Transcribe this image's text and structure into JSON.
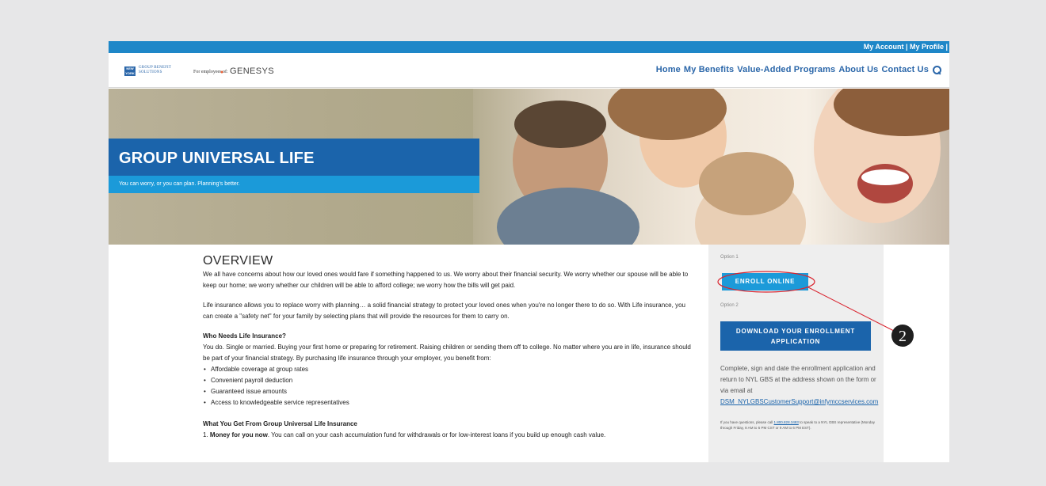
{
  "utility": {
    "text": "My Account | My Profile |"
  },
  "header": {
    "nyl_logo": "NEW YORK LIFE",
    "gbs_line1": "GROUP BENEFIT",
    "gbs_line2": "SOLUTIONS",
    "for_employees": "For employees of:",
    "client": "GENESYS"
  },
  "nav": {
    "items": [
      "Home",
      "My Benefits",
      "Value-Added Programs",
      "About Us",
      "Contact Us"
    ],
    "search_icon": "search-icon"
  },
  "hero": {
    "title": "GROUP UNIVERSAL LIFE",
    "subtitle": "You can worry, or you can plan. Planning's better."
  },
  "overview": {
    "title": "OVERVIEW",
    "p1": "We all have concerns about how our loved ones would fare if something happened to us. We worry about their financial security. We worry whether our spouse will be able to keep our home; we worry whether our children will be able to afford college; we worry how the bills will get paid.",
    "p2": "Life insurance allows you to replace worry with planning… a solid financial strategy to protect your loved ones when you're no longer there to do so. With Life insurance, you can create a \"safety net\" for your family by selecting plans that will provide the resources for them to carry on.",
    "who_heading": "Who Needs Life Insurance?",
    "who_text": "You do. Single or married. Buying your first home or preparing for retirement. Raising children or sending them off to college. No matter where you are in life, insurance should be part of your financial strategy. By purchasing life insurance through your employer, you benefit from:",
    "benefits": [
      "Affordable coverage at group rates",
      "Convenient payroll deduction",
      "Guaranteed issue amounts",
      "Access to knowledgeable service representatives"
    ],
    "what_heading": "What You Get From Group Universal Life Insurance",
    "money_prefix": "1. ",
    "money_bold": "Money for you now",
    "money_text": ". You can call on your cash accumulation fund for withdrawals or for low-interest loans if you build up enough cash value."
  },
  "sidebar": {
    "option1": "Option 1",
    "enroll": "ENROLL ONLINE",
    "option2": "Option 2",
    "download_line1": "DOWNLOAD YOUR ENROLLMENT",
    "download_line2": "APPLICATION",
    "instructions": "Complete, sign and date the enrollment application and return to NYL GBS at the address shown on the form or via email at",
    "email": "DSM_NYLGBSCustomerSupport@infymccservices.com",
    "small_prefix": "If you have questions, please call ",
    "phone": "1.800.828.3483",
    "small_suffix": " to speak to a NYL GBS representative (Monday through Friday, 8 AM to 5 PM CST or 9 AM to 6 PM EST)."
  },
  "annotation": {
    "number": "2",
    "color": "#d9232e"
  }
}
